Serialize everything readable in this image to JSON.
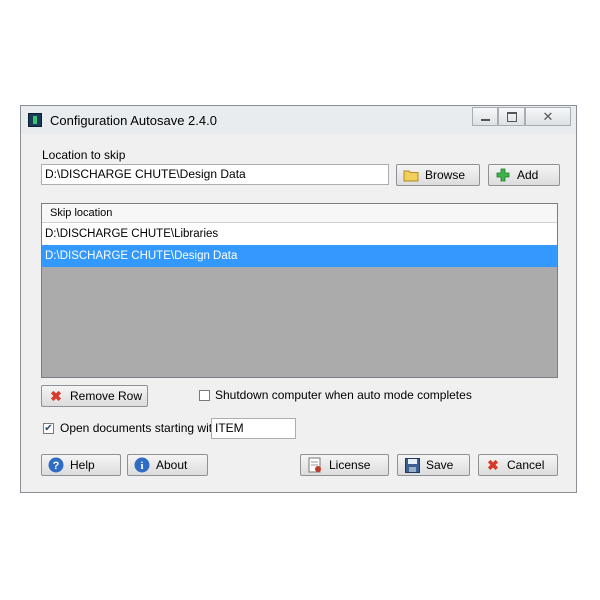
{
  "window": {
    "title": "Configuration Autosave 2.4.0",
    "controls": {
      "minimize_icon": "minimize-icon",
      "maximize_icon": "maximize-icon",
      "close_icon": "close-icon"
    }
  },
  "location": {
    "label": "Location to skip",
    "value": "D:\\DISCHARGE CHUTE\\Design Data",
    "browse_label": "Browse",
    "add_label": "Add"
  },
  "skip_list": {
    "header": "Skip location",
    "rows": [
      {
        "path": "D:\\DISCHARGE CHUTE\\Libraries",
        "selected": false
      },
      {
        "path": "D:\\DISCHARGE CHUTE\\Design Data",
        "selected": true
      }
    ]
  },
  "remove_row_label": "Remove Row",
  "shutdown": {
    "label": "Shutdown computer when auto mode completes",
    "checked": false
  },
  "open_docs": {
    "label": "Open documents starting with",
    "checked": true,
    "value": "ITEM"
  },
  "footer": {
    "help_label": "Help",
    "about_label": "About",
    "license_label": "License",
    "save_label": "Save",
    "cancel_label": "Cancel"
  },
  "colors": {
    "selection": "#3399ff",
    "list_background": "#ababab",
    "window_background": "#f0f0f0"
  }
}
